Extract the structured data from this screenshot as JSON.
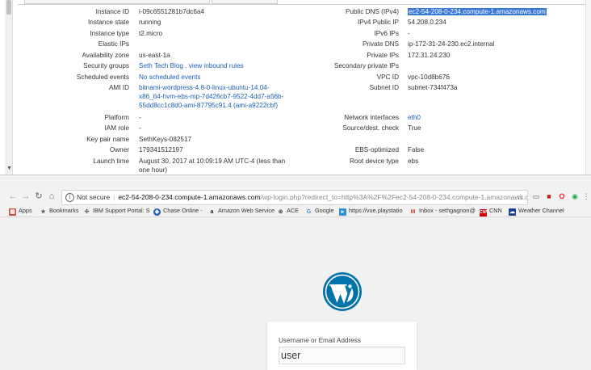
{
  "aws": {
    "details": [
      {
        "label": "Instance ID",
        "value": "i-09c6551281b7dc6a4"
      },
      {
        "label": "Instance state",
        "value": "running"
      },
      {
        "label": "Instance type",
        "value": "t2.micro"
      },
      {
        "label": "Elastic IPs",
        "value": ""
      },
      {
        "label": "Availability zone",
        "value": "us-east-1a"
      },
      {
        "label": "Security groups",
        "value": "Seth Tech Blog . view inbound rules"
      },
      {
        "label": "Scheduled events",
        "value": "No scheduled events"
      },
      {
        "label": "AMI ID",
        "value": "bitnami-wordpress-4.8-0-linux-ubuntu-14.04-x86_64-hvm-ebs-mp-7d426cb7-9522-4dd7-a56b-55dd8cc1c8d0-ami-87795c91.4 (ami-a9222cbf)"
      },
      {
        "label": "Platform",
        "value": "-"
      },
      {
        "label": "IAM role",
        "value": "-"
      },
      {
        "label": "Key pair name",
        "value": "SethKeys-082517"
      },
      {
        "label": "Owner",
        "value": "179341512197"
      },
      {
        "label": "Launch time",
        "value": "August 30, 2017 at 10:09:19 AM UTC-4 (less than one hour)"
      }
    ],
    "ami_lines": [
      "bitnami-wordpress-4.8-0-linux-ubuntu-14.04-",
      "x86_64-hvm-ebs-mp-7d426cb7-9522-4dd7-a56b-",
      "55dd8cc1c8d0-ami-87795c91.4 (ami-a9222cbf)"
    ],
    "launch_lines": [
      "August 30, 2017 at 10:09:19 AM UTC-4 (less than",
      "one hour)"
    ],
    "network": [
      {
        "label": "Public DNS (IPv4)",
        "value": "ec2-54-208-0-234.compute-1.amazonaws.com"
      },
      {
        "label": "IPv4 Public IP",
        "value": "54.208.0.234"
      },
      {
        "label": "IPv6 IPs",
        "value": "-"
      },
      {
        "label": "Private DNS",
        "value": "ip-172-31-24-230.ec2.internal"
      },
      {
        "label": "Private IPs",
        "value": "172.31.24.230"
      },
      {
        "label": "Secondary private IPs",
        "value": ""
      },
      {
        "label": "VPC ID",
        "value": "vpc-10d8b676"
      },
      {
        "label": "Subnet ID",
        "value": "subnet-734f473a"
      },
      {
        "label": "Network interfaces",
        "value": "eth0"
      },
      {
        "label": "Source/dest. check",
        "value": "True"
      },
      {
        "label": "EBS-optimized",
        "value": "False"
      },
      {
        "label": "Root device type",
        "value": "ebs"
      }
    ],
    "security_group_link": "Seth Tech Blog",
    "security_group_sep": ".",
    "inbound_rules_link": "view inbound rules"
  },
  "browser": {
    "not_secure": "Not secure",
    "url_main": "ec2-54-208-0-234.compute-1.amazonaws.com",
    "url_rest": "/wp-login.php?redirect_to=http%3A%2F%2Fec2-54-208-0-234.compute-1.amazonaws.co...",
    "bookmarks": [
      {
        "label": "Apps",
        "icon": "apps-icon",
        "color": "#d44638"
      },
      {
        "label": "Bookmarks",
        "icon": "star-icon",
        "color": "#5f6368"
      },
      {
        "label": "IBM Support Portal: S",
        "icon": "ibm-icon",
        "color": "#555555"
      },
      {
        "label": "Chase Online -",
        "icon": "chase-icon",
        "color": "#1a5fb4"
      },
      {
        "label": "Amazon Web Service",
        "icon": "amazon-icon",
        "color": "#222222"
      },
      {
        "label": "ACE",
        "icon": "ace-icon",
        "color": "#555555"
      },
      {
        "label": "Google",
        "icon": "google-icon",
        "color": "#4285f4"
      },
      {
        "label": "https://vue.playstatio",
        "icon": "playstation-icon",
        "color": "#2d8fd5"
      },
      {
        "label": "Inbox - sethgagnon@",
        "icon": "gmail-icon",
        "color": "#d44638"
      },
      {
        "label": "CNN",
        "icon": "cnn-icon",
        "color": "#cc0000"
      },
      {
        "label": "Weather Channel",
        "icon": "weather-icon",
        "color": "#1b3f8f"
      }
    ]
  },
  "wp": {
    "username_label": "Username or Email Address",
    "username_value": "user"
  }
}
